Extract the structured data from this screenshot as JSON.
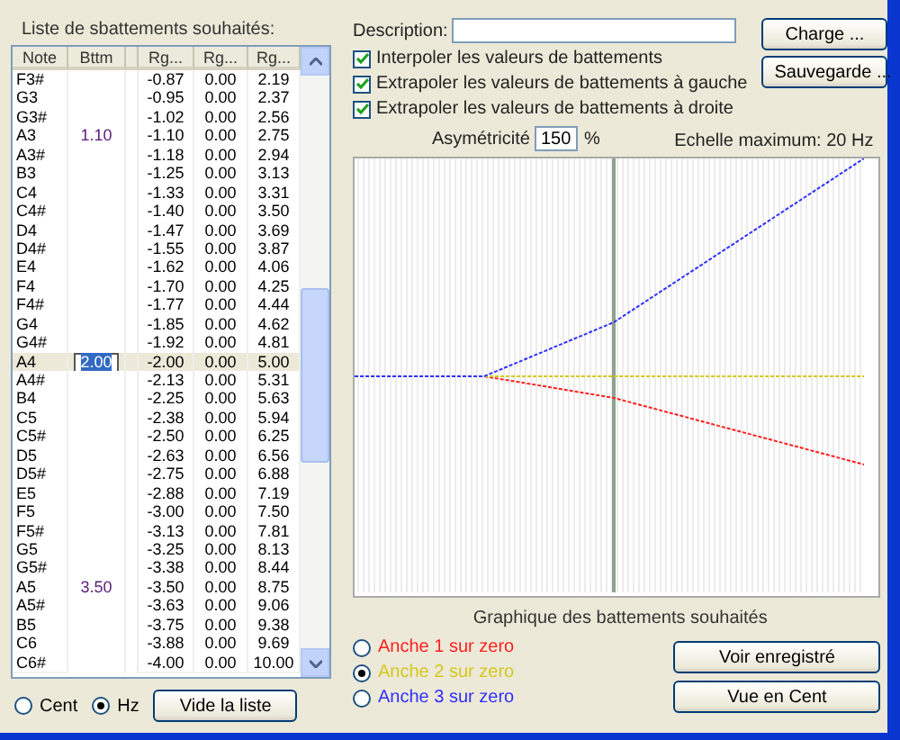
{
  "beat_list": {
    "title": "Liste de sbattements souhaités:",
    "columns": [
      "Note",
      "Bttm",
      "Rg...",
      "Rg...",
      "Rg..."
    ],
    "rows": [
      {
        "note": "F3#",
        "range_1": "-0.87",
        "range_2": "0.00",
        "range_3": "2.19",
        "selected": false
      },
      {
        "note": "G3",
        "range_1": "-0.95",
        "range_2": "0.00",
        "range_3": "2.37",
        "selected": false
      },
      {
        "note": "G3#",
        "range_1": "-1.02",
        "range_2": "0.00",
        "range_3": "2.56",
        "selected": false
      },
      {
        "note": "A3",
        "bttm": "1.10",
        "range_1": "-1.10",
        "range_2": "0.00",
        "range_3": "2.75",
        "selected": false
      },
      {
        "note": "A3#",
        "range_1": "-1.18",
        "range_2": "0.00",
        "range_3": "2.94",
        "selected": false
      },
      {
        "note": "B3",
        "range_1": "-1.25",
        "range_2": "0.00",
        "range_3": "3.13",
        "selected": false
      },
      {
        "note": "C4",
        "range_1": "-1.33",
        "range_2": "0.00",
        "range_3": "3.31",
        "selected": false
      },
      {
        "note": "C4#",
        "range_1": "-1.40",
        "range_2": "0.00",
        "range_3": "3.50",
        "selected": false
      },
      {
        "note": "D4",
        "range_1": "-1.47",
        "range_2": "0.00",
        "range_3": "3.69",
        "selected": false
      },
      {
        "note": "D4#",
        "range_1": "-1.55",
        "range_2": "0.00",
        "range_3": "3.87",
        "selected": false
      },
      {
        "note": "E4",
        "range_1": "-1.62",
        "range_2": "0.00",
        "range_3": "4.06",
        "selected": false
      },
      {
        "note": "F4",
        "range_1": "-1.70",
        "range_2": "0.00",
        "range_3": "4.25",
        "selected": false
      },
      {
        "note": "F4#",
        "range_1": "-1.77",
        "range_2": "0.00",
        "range_3": "4.44",
        "selected": false
      },
      {
        "note": "G4",
        "range_1": "-1.85",
        "range_2": "0.00",
        "range_3": "4.62",
        "selected": false
      },
      {
        "note": "G4#",
        "range_1": "-1.92",
        "range_2": "0.00",
        "range_3": "4.81",
        "selected": false
      },
      {
        "note": "A4",
        "bttm": "2.00",
        "range_1": "-2.00",
        "range_2": "0.00",
        "range_3": "5.00",
        "selected": true
      },
      {
        "note": "A4#",
        "range_1": "-2.13",
        "range_2": "0.00",
        "range_3": "5.31",
        "selected": false
      },
      {
        "note": "B4",
        "range_1": "-2.25",
        "range_2": "0.00",
        "range_3": "5.63",
        "selected": false
      },
      {
        "note": "C5",
        "range_1": "-2.38",
        "range_2": "0.00",
        "range_3": "5.94",
        "selected": false
      },
      {
        "note": "C5#",
        "range_1": "-2.50",
        "range_2": "0.00",
        "range_3": "6.25",
        "selected": false
      },
      {
        "note": "D5",
        "range_1": "-2.63",
        "range_2": "0.00",
        "range_3": "6.56",
        "selected": false
      },
      {
        "note": "D5#",
        "range_1": "-2.75",
        "range_2": "0.00",
        "range_3": "6.88",
        "selected": false
      },
      {
        "note": "E5",
        "range_1": "-2.88",
        "range_2": "0.00",
        "range_3": "7.19",
        "selected": false
      },
      {
        "note": "F5",
        "range_1": "-3.00",
        "range_2": "0.00",
        "range_3": "7.50",
        "selected": false
      },
      {
        "note": "F5#",
        "range_1": "-3.13",
        "range_2": "0.00",
        "range_3": "7.81",
        "selected": false
      },
      {
        "note": "G5",
        "range_1": "-3.25",
        "range_2": "0.00",
        "range_3": "8.13",
        "selected": false
      },
      {
        "note": "G5#",
        "range_1": "-3.38",
        "range_2": "0.00",
        "range_3": "8.44",
        "selected": false
      },
      {
        "note": "A5",
        "bttm": "3.50",
        "range_1": "-3.50",
        "range_2": "0.00",
        "range_3": "8.75",
        "selected": false
      },
      {
        "note": "A5#",
        "range_1": "-3.63",
        "range_2": "0.00",
        "range_3": "9.06",
        "selected": false
      },
      {
        "note": "B5",
        "range_1": "-3.75",
        "range_2": "0.00",
        "range_3": "9.38",
        "selected": false
      },
      {
        "note": "C6",
        "range_1": "-3.88",
        "range_2": "0.00",
        "range_3": "9.69",
        "selected": false
      },
      {
        "note": "C6#",
        "range_1": "-4.00",
        "range_2": "0.00",
        "range_3": "10.00",
        "selected": false
      }
    ]
  },
  "units": [
    {
      "label": "Cent",
      "selected": false
    },
    {
      "label": "Hz",
      "selected": true
    }
  ],
  "clear_button": "Vide la liste",
  "description": {
    "label": "Description:"
  },
  "file_buttons": [
    "Charge ...",
    "Sauvegarde ..."
  ],
  "options": [
    {
      "label": "Interpoler les valeurs de battements",
      "checked": true
    },
    {
      "label": "Extrapoler les valeurs de battements à gauche",
      "checked": true
    },
    {
      "label": "Extrapoler les valeurs de battements à droite",
      "checked": true
    }
  ],
  "asymmetry": {
    "label": "Asymétricité",
    "value": "150",
    "unit": "%"
  },
  "scale_label": "Echelle maximum: 20 Hz",
  "graph_caption": "Graphique des battements souhaités",
  "reeds": [
    {
      "label": "Anche 1 sur zero",
      "selected": false,
      "color": "#ff2020"
    },
    {
      "label": "Anche 2 sur zero",
      "selected": true,
      "color": "#d4c81c"
    },
    {
      "label": "Anche 3 sur zero",
      "selected": false,
      "color": "#3030ff"
    }
  ],
  "view_buttons": [
    "Voir enregistré",
    "Vue en Cent"
  ]
}
